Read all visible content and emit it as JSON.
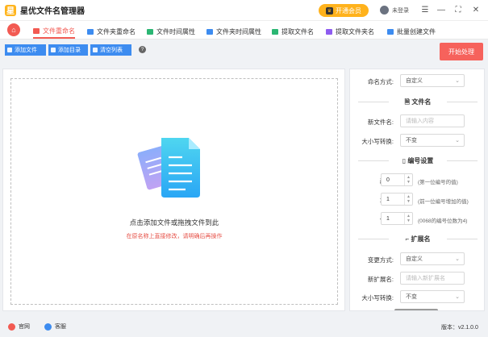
{
  "app": {
    "title": "星优文件名管理器",
    "logo_char": "星"
  },
  "header": {
    "vip_label": "开通会员",
    "login_label": "未登录"
  },
  "tabs": [
    {
      "label": "文件重命名",
      "active": true,
      "icon_color": "#f25a52"
    },
    {
      "label": "文件夹重命名",
      "active": false,
      "icon_color": "#3d8cf0"
    },
    {
      "label": "文件时间属性",
      "active": false,
      "icon_color": "#2bb673"
    },
    {
      "label": "文件夹时间属性",
      "active": false,
      "icon_color": "#3d8cf0"
    },
    {
      "label": "提取文件名",
      "active": false,
      "icon_color": "#2bb673"
    },
    {
      "label": "提取文件夹名",
      "active": false,
      "icon_color": "#8e5cf0"
    },
    {
      "label": "批量创建文件",
      "active": false,
      "icon_color": "#3d8cf0"
    }
  ],
  "toolbar": {
    "add_file": "添加文件",
    "add_dir": "添加目录",
    "clear_list": "清空列表",
    "start": "开始处理"
  },
  "dropzone": {
    "main_text": "点击添加文件或拖拽文件到此",
    "sub_text": "在原名称上直接修改，请明确后再操作"
  },
  "settings": {
    "naming_mode_label": "命名方式:",
    "naming_mode_value": "自定义",
    "filename_section": "文件名",
    "new_name_label": "新文件名:",
    "new_name_placeholder": "请输入内容",
    "case_label": "大小写转换:",
    "case_value": "不变",
    "numbering_section": "编号设置",
    "start_label": "起始:",
    "start_value": "0",
    "start_hint": "(第一位编号的值)",
    "step_label": "增量:",
    "step_value": "1",
    "step_hint": "(前一位编号增加的值)",
    "digits_label": "位数:",
    "digits_value": "1",
    "digits_hint": "(0068的编号位数为4)",
    "ext_section": "扩展名",
    "change_mode_label": "变更方式:",
    "change_mode_value": "自定义",
    "new_ext_label": "新扩展名:",
    "new_ext_placeholder": "请输入新扩展名",
    "ext_case_label": "大小写转换:",
    "ext_case_value": "不变"
  },
  "statusbar": {
    "website": "官网",
    "support": "客服",
    "version": "版本：v2.1.0.0"
  },
  "colors": {
    "accent": "#f25a52",
    "primary": "#3d8cf0",
    "vip": "#ffb21c"
  }
}
